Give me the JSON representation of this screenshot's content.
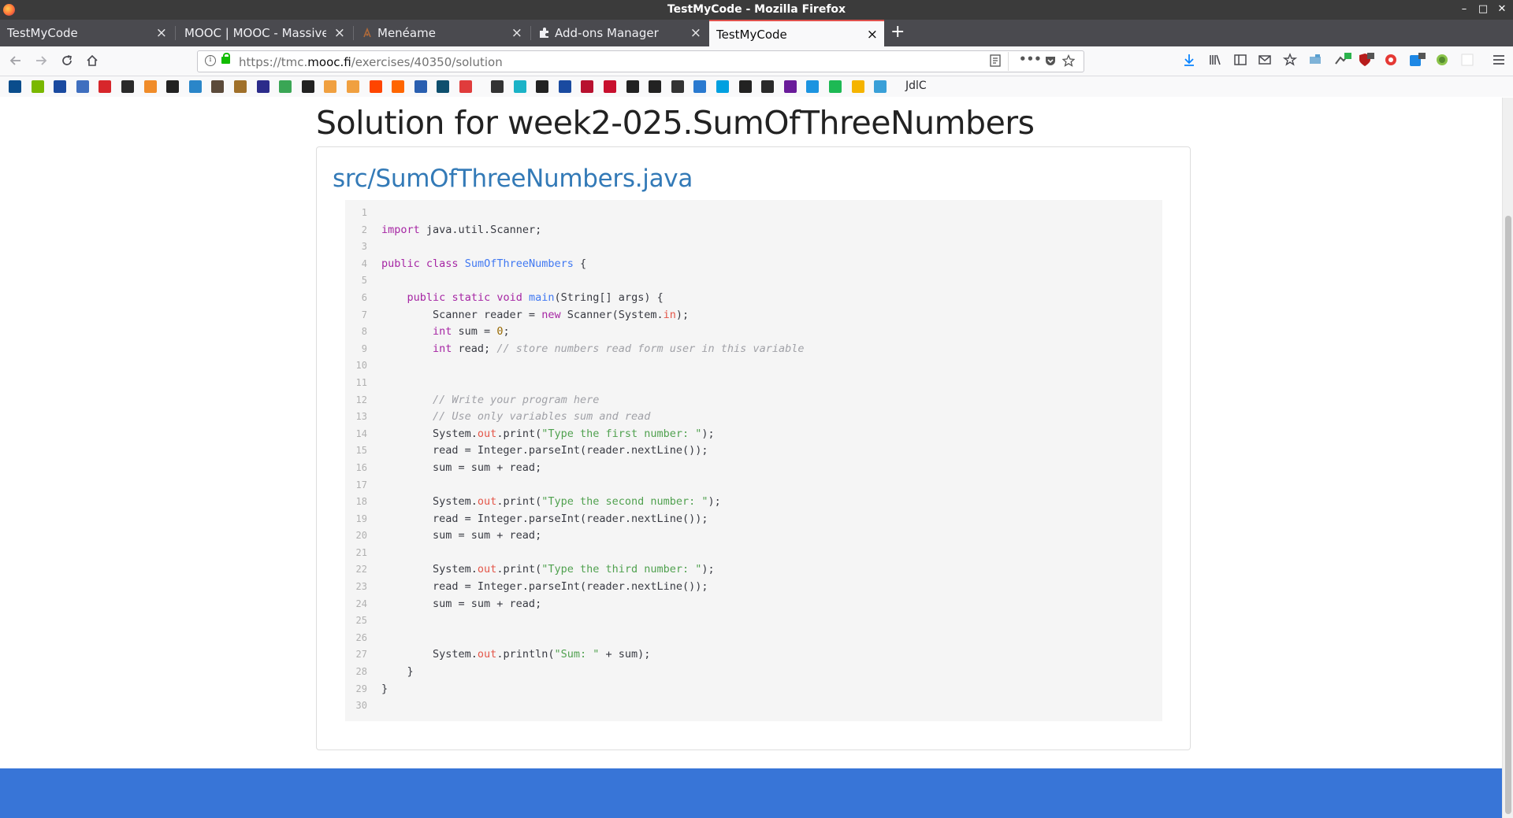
{
  "window": {
    "title": "TestMyCode - Mozilla Firefox"
  },
  "tabs": [
    {
      "label": "TestMyCode",
      "active": false
    },
    {
      "label": "MOOC | MOOC - Massive",
      "active": false
    },
    {
      "label": "Menéame",
      "active": false
    },
    {
      "label": "Add-ons Manager",
      "active": false
    },
    {
      "label": "TestMyCode",
      "active": true
    }
  ],
  "tab_close": "×",
  "new_tab": "+",
  "navbar": {
    "url_prefix": "https://tmc.",
    "url_domain": "mooc.fi",
    "url_path": "/exercises/40350/solution"
  },
  "bookmarks": {
    "last_label": "JdlC",
    "colors": [
      "#0a4d8c",
      "#7ab800",
      "#1a4aa0",
      "#3f6fbf",
      "#d7262b",
      "#2a2a2a",
      "#f08c2a",
      "#222222",
      "#2a86c9",
      "#5b4a3a",
      "#a0702a",
      "#2b2b8a",
      "#3aa655",
      "#222222",
      "#f0a040",
      "#f0a040",
      "#ff4500",
      "#ff6600",
      "#2a5fb0",
      "#0e4f6e",
      "#e03c3c",
      "#333333",
      "#1bb3c7",
      "#222222",
      "#1a4aa0",
      "#b8112f",
      "#c8102e",
      "#222222",
      "#222222",
      "#333333",
      "#2a7ad0",
      "#00a0e0",
      "#222222",
      "#2a2a2a",
      "#6a1b9a",
      "#1c94e0",
      "#1db954",
      "#f5b400",
      "#3aa0d8"
    ]
  },
  "page": {
    "title": "Solution for week2-025.SumOfThreeNumbers",
    "file_link": "src/SumOfThreeNumbers.java"
  },
  "code_lines": [
    "",
    "import java.util.Scanner;",
    "",
    "public class SumOfThreeNumbers {",
    "",
    "    public static void main(String[] args) {",
    "        Scanner reader = new Scanner(System.in);",
    "        int sum = 0;",
    "        int read; // store numbers read form user in this variable",
    "",
    "",
    "        // Write your program here",
    "        // Use only variables sum and read",
    "        System.out.print(\"Type the first number: \");",
    "        read = Integer.parseInt(reader.nextLine());",
    "        sum = sum + read;",
    "",
    "        System.out.print(\"Type the second number: \");",
    "        read = Integer.parseInt(reader.nextLine());",
    "        sum = sum + read;",
    "",
    "        System.out.print(\"Type the third number: \");",
    "        read = Integer.parseInt(reader.nextLine());",
    "        sum = sum + read;",
    "",
    "",
    "        System.out.println(\"Sum: \" + sum);",
    "    }",
    "}",
    ""
  ],
  "colors": {
    "link": "#337ab7",
    "footer": "#3875d7",
    "active_tab_accent": "#e0514d"
  }
}
